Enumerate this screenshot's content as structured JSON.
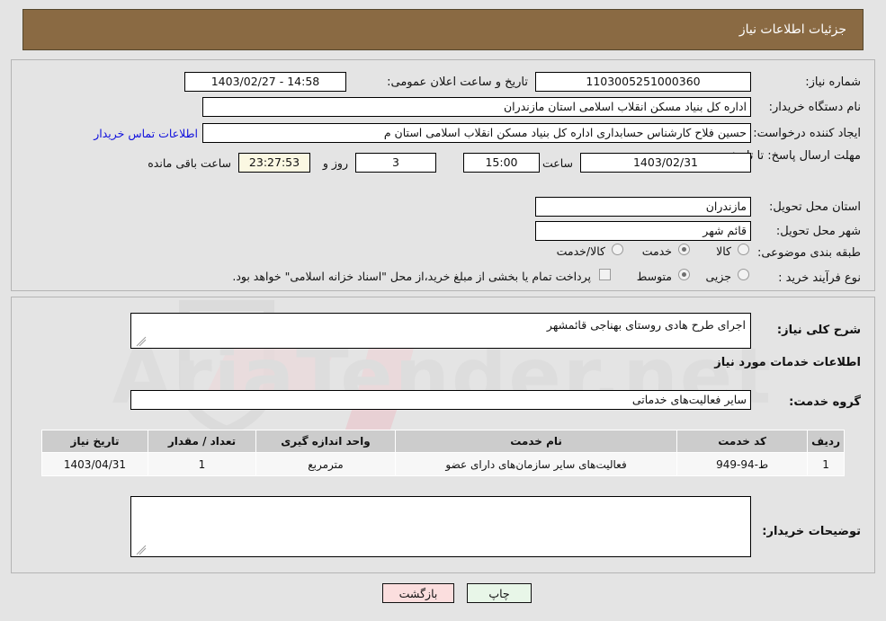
{
  "header": {
    "title": "جزئیات اطلاعات نیاز"
  },
  "form": {
    "need_number_label": "شماره نیاز:",
    "need_number_value": "1103005251000360",
    "announce_label": "تاریخ و ساعت اعلان عمومی:",
    "announce_value": "14:58 - 1403/02/27",
    "buyer_org_label": "نام دستگاه خریدار:",
    "buyer_org_value": "اداره کل بنیاد مسکن انقلاب اسلامی استان مازندران",
    "requester_label": "ایجاد کننده درخواست:",
    "requester_value": "حسین فلاح کارشناس حسابداری اداره کل بنیاد مسکن انقلاب اسلامی استان م",
    "contact_link": "اطلاعات تماس خریدار",
    "deadline_label": "مهلت ارسال پاسخ: تا تاریخ:",
    "deadline_date": "1403/02/31",
    "time_label": "ساعت",
    "deadline_time": "15:00",
    "days_value": "3",
    "days_label": "روز و",
    "countdown_value": "23:27:53",
    "remaining_label": "ساعت باقی مانده",
    "province_label": "استان محل تحویل:",
    "province_value": "مازندران",
    "city_label": "شهر محل تحویل:",
    "city_value": "قائم شهر",
    "category_label": "طبقه بندی موضوعی:",
    "category_options": [
      "کالا",
      "خدمت",
      "کالا/خدمت"
    ],
    "category_selected": "خدمت",
    "process_label": "نوع فرآیند خرید :",
    "process_options": [
      "جزیی",
      "متوسط"
    ],
    "process_selected": "متوسط",
    "treasury_note": "پرداخت تمام یا بخشی از مبلغ خرید،از محل \"اسناد خزانه اسلامی\" خواهد بود.",
    "treasury_checked": false
  },
  "need": {
    "summary_label": "شرح کلی نیاز:",
    "summary_value": "اجرای طرح هادی روستای بهناجی قائمشهر",
    "services_section_title": "اطلاعات خدمات مورد نیاز",
    "service_group_label": "گروه خدمت:",
    "service_group_value": "سایر فعالیت‌های خدماتی"
  },
  "table": {
    "headers": [
      "ردیف",
      "کد خدمت",
      "نام خدمت",
      "واحد اندازه گیری",
      "تعداد / مقدار",
      "تاریخ نیاز"
    ],
    "rows": [
      {
        "row": "1",
        "code": "ط-94-949",
        "name": "فعالیت‌های سایر سازمان‌های دارای عضو",
        "unit": "مترمربع",
        "qty": "1",
        "date": "1403/04/31"
      }
    ]
  },
  "comments": {
    "label": "توضیحات خریدار:",
    "value": ""
  },
  "buttons": {
    "print": "چاپ",
    "back": "بازگشت"
  },
  "watermark": {
    "text": "AriaTender.net"
  },
  "colors": {
    "header_bg": "#8a6a43",
    "link": "#1010dd",
    "countdown_bg": "#fbf8e2",
    "print_btn_bg": "#e8f6e8",
    "back_btn_bg": "#fbdede",
    "table_header_bg": "#cccccc"
  }
}
